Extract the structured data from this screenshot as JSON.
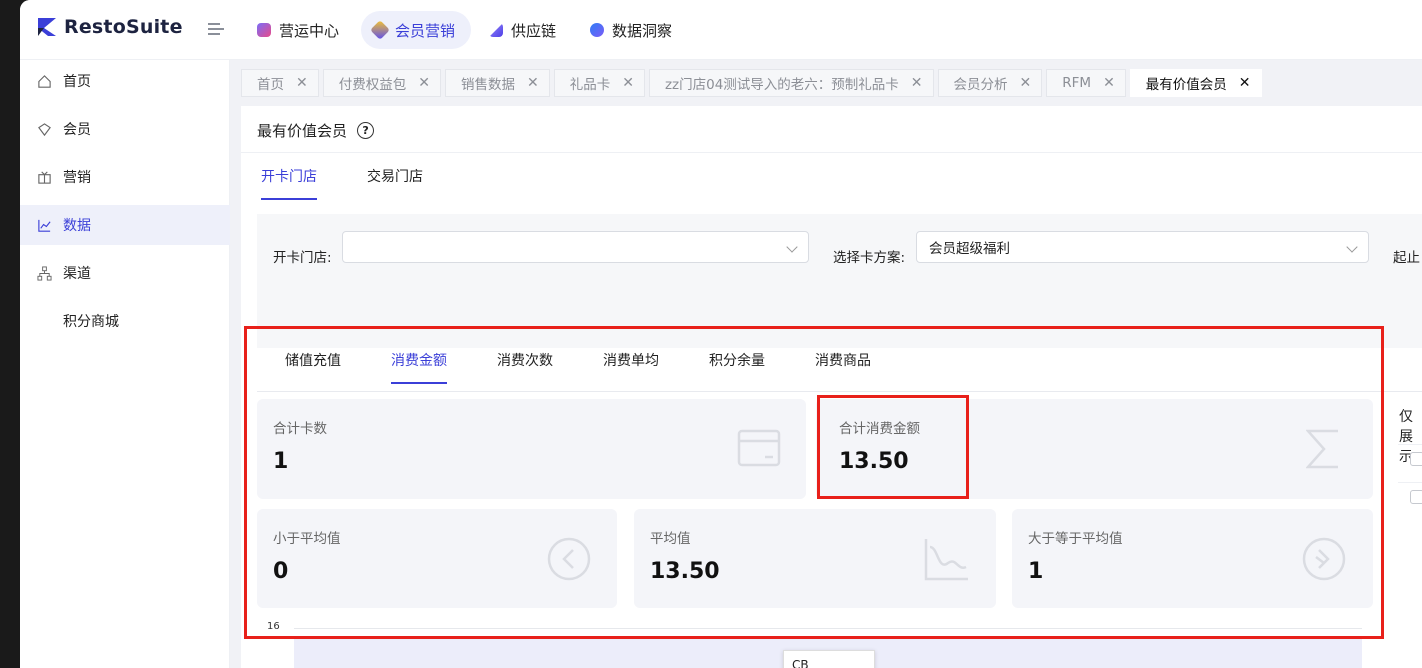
{
  "app": {
    "name": "RestoSuite"
  },
  "topnav": [
    {
      "label": "营运中心",
      "color": "#5b4cf0"
    },
    {
      "label": "会员营销",
      "color": "#f4c430"
    },
    {
      "label": "供应链",
      "color": "#6a5cf5"
    },
    {
      "label": "数据洞察",
      "color": "#2f7df6"
    }
  ],
  "sidebar": [
    {
      "label": "首页",
      "icon": "home-icon"
    },
    {
      "label": "会员",
      "icon": "member-icon"
    },
    {
      "label": "营销",
      "icon": "marketing-icon"
    },
    {
      "label": "数据",
      "icon": "chart-icon"
    },
    {
      "label": "渠道",
      "icon": "channel-icon"
    },
    {
      "label": "积分商城",
      "icon": ""
    }
  ],
  "tabs": [
    {
      "label": "首页"
    },
    {
      "label": "付费权益包"
    },
    {
      "label": "销售数据"
    },
    {
      "label": "礼品卡"
    },
    {
      "label": "zz门店04测试导入的老六：预制礼品卡"
    },
    {
      "label": "会员分析"
    },
    {
      "label": "RFM"
    },
    {
      "label": "最有价值会员"
    }
  ],
  "page": {
    "title": "最有价值会员",
    "help": "?",
    "subtabs": [
      "开卡门店",
      "交易门店"
    ]
  },
  "filter": {
    "store_label": "开卡门店:",
    "store_value": "",
    "plan_label": "选择卡方案:",
    "plan_value": "会员超级福利",
    "date_label": "起止"
  },
  "metric_tabs": [
    "储值充值",
    "消费金额",
    "消费次数",
    "消费单均",
    "积分余量",
    "消费商品"
  ],
  "cards": {
    "total_cards": {
      "label": "合计卡数",
      "value": "1"
    },
    "total_amount": {
      "label": "合计消费金额",
      "value": "13.50"
    },
    "below_avg": {
      "label": "小于平均值",
      "value": "0"
    },
    "avg": {
      "label": "平均值",
      "value": "13.50"
    },
    "above_avg": {
      "label": "大于等于平均值",
      "value": "1"
    }
  },
  "right_panel": {
    "label": "仅展示"
  },
  "chart": {
    "tick_top": "16",
    "tooltip": "CB"
  },
  "colors": {
    "accent": "#3b3fd8",
    "highlight": "#e8201a"
  }
}
